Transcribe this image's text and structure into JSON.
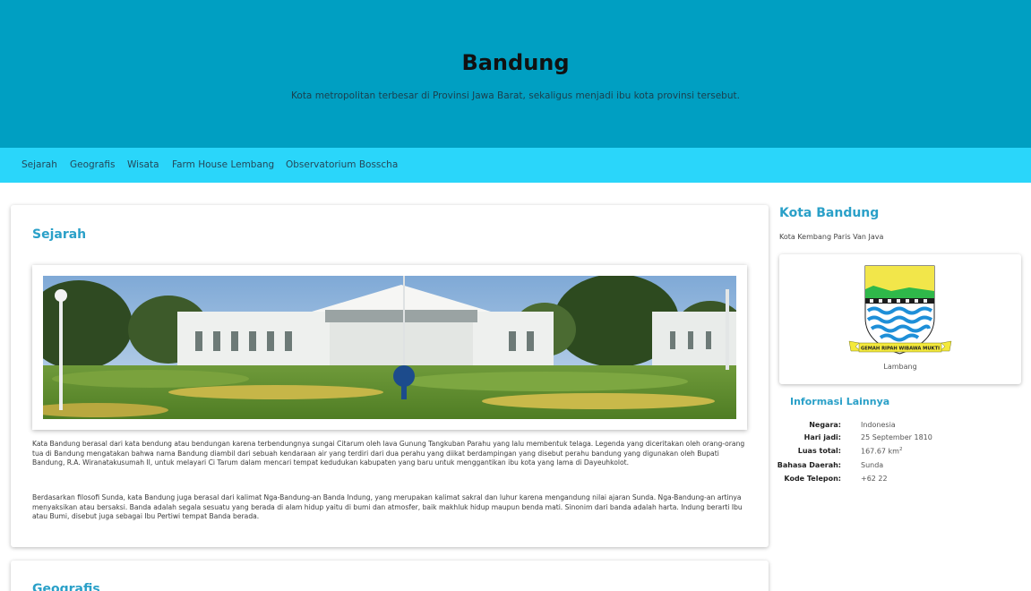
{
  "header": {
    "title": "Bandung",
    "subtitle": "Kota metropolitan terbesar di Provinsi Jawa Barat, sekaligus menjadi ibu kota provinsi tersebut."
  },
  "nav": {
    "items": [
      "Sejarah",
      "Geografis",
      "Wisata",
      "Farm House Lembang",
      "Observatorium Bosscha"
    ]
  },
  "main": {
    "sejarah": {
      "title": "Sejarah",
      "paragraphs": [
        "Kata Bandung berasal dari kata bendung atau bendungan karena terbendungnya sungai Citarum oleh lava Gunung Tangkuban Parahu yang lalu membentuk telaga. Legenda yang diceritakan oleh orang-orang tua di Bandung mengatakan bahwa nama Bandung diambil dari sebuah kendaraan air yang terdiri dari dua perahu yang diikat berdampingan yang disebut perahu bandung yang digunakan oleh Bupati Bandung, R.A. Wiranatakusumah II, untuk melayari Ci Tarum dalam mencari tempat kedudukan kabupaten yang baru untuk menggantikan ibu kota yang lama di Dayeuhkolot.",
        "Berdasarkan filosofi Sunda, kata Bandung juga berasal dari kalimat Nga-Bandung-an Banda Indung, yang merupakan kalimat sakral dan luhur karena mengandung nilai ajaran Sunda. Nga-Bandung-an artinya menyaksikan atau bersaksi. Banda adalah segala sesuatu yang berada di alam hidup yaitu di bumi dan atmosfer, baik makhluk hidup maupun benda mati. Sinonim dari banda adalah harta. Indung berarti Ibu atau Bumi, disebut juga sebagai Ibu Pertiwi tempat Banda berada."
      ]
    },
    "geografis": {
      "title": "Geografis"
    }
  },
  "sidebar": {
    "title": "Kota Bandung",
    "subtitle": "Kota Kembang Paris Van Java",
    "logo_caption": "Lambang",
    "logo_motto": "GEMAH RIPAH WIBAWA MUKTI",
    "info_title": "Informasi Lainnya",
    "info": [
      {
        "key": "Negara:",
        "value": "Indonesia"
      },
      {
        "key": "Hari jadi:",
        "value": "25 September 1810"
      },
      {
        "key": "Luas total:",
        "value": "167.67 km",
        "sup": "2"
      },
      {
        "key": "Bahasa Daerah:",
        "value": "Sunda"
      },
      {
        "key": "Kode Telepon:",
        "value": "+62 22"
      }
    ]
  },
  "colors": {
    "header_bg": "#009fc2",
    "nav_bg": "#2ad6fa",
    "accent": "#2aa0c8"
  }
}
